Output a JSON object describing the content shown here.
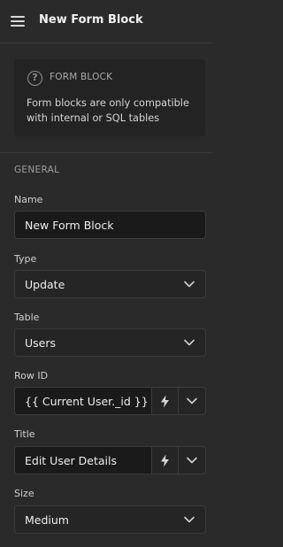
{
  "header": {
    "title": "New Form Block",
    "menu_icon": "hamburger-menu-icon"
  },
  "info": {
    "icon": "question-circle-icon",
    "icon_glyph": "?",
    "title": "FORM BLOCK",
    "message": "Form blocks are only compatible with internal or SQL tables"
  },
  "section": {
    "title": "GENERAL"
  },
  "fields": {
    "name": {
      "label": "Name",
      "value": "New Form Block"
    },
    "type": {
      "label": "Type",
      "value": "Update"
    },
    "table": {
      "label": "Table",
      "value": "Users"
    },
    "row_id": {
      "label": "Row ID",
      "value": "{{ Current User._id }}"
    },
    "title": {
      "label": "Title",
      "value": "Edit User Details"
    },
    "size": {
      "label": "Size",
      "value": "Medium"
    }
  },
  "colors": {
    "background": "#2a2a2a",
    "input_bg": "#1a1a1a",
    "text": "#eeeeee"
  }
}
